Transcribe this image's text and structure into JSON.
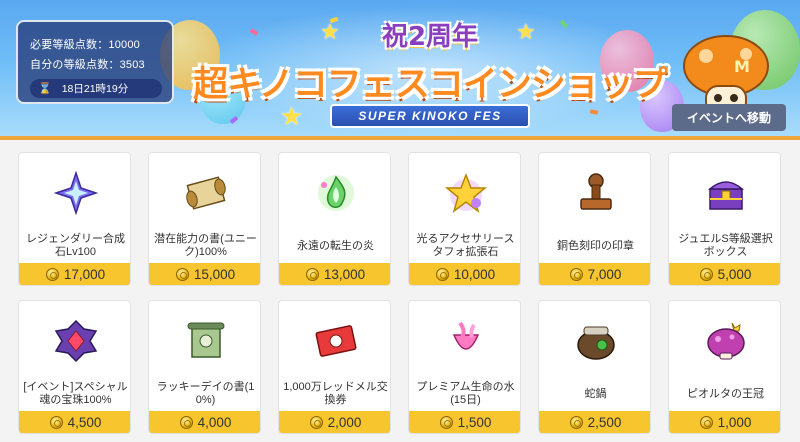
{
  "banner": {
    "info": {
      "required_points": "必要等級点数：10000",
      "own_points": "自分の等級点数：3503",
      "timer": "18日21時19分"
    },
    "subtitle": "祝2周年",
    "title": "超キノコフェスコインショップ",
    "ribbon": "SUPER KINOKO FES",
    "event_button": "イベントへ移動"
  },
  "items": [
    {
      "name": "レジェンダリー合成石Lv100",
      "price": "17,000",
      "icon": "legendary-stone-icon"
    },
    {
      "name": "潜在能力の書(ユニーク)100%",
      "price": "15,000",
      "icon": "potential-scroll-icon"
    },
    {
      "name": "永遠の転生の炎",
      "price": "13,000",
      "icon": "eternal-flame-icon"
    },
    {
      "name": "光るアクセサリースタフォ拡張石",
      "price": "10,000",
      "icon": "star-stone-icon"
    },
    {
      "name": "銅色刻印の印章",
      "price": "7,000",
      "icon": "stamp-icon"
    },
    {
      "name": "ジュエルS等級選択ボックス",
      "price": "5,000",
      "icon": "jewel-box-icon"
    },
    {
      "name": "[イベント]スペシャル魂の宝珠100%",
      "price": "4,500",
      "icon": "soul-gem-icon"
    },
    {
      "name": "ラッキーデイの書(10%)",
      "price": "4,000",
      "icon": "lucky-scroll-icon"
    },
    {
      "name": "1,000万レッドメル交換券",
      "price": "2,000",
      "icon": "meso-ticket-icon"
    },
    {
      "name": "プレミアム生命の水(15日)",
      "price": "1,500",
      "icon": "water-of-life-icon"
    },
    {
      "name": "蛇鍋",
      "price": "2,500",
      "icon": "snake-pot-icon"
    },
    {
      "name": "ピオルタの王冠",
      "price": "1,000",
      "icon": "mushroom-crown-icon"
    }
  ],
  "colors": {
    "price_bar": "#f7c52d",
    "banner_border": "#f0a53a",
    "title": "#ff8a1f",
    "event_button": "#5d6b8a"
  }
}
